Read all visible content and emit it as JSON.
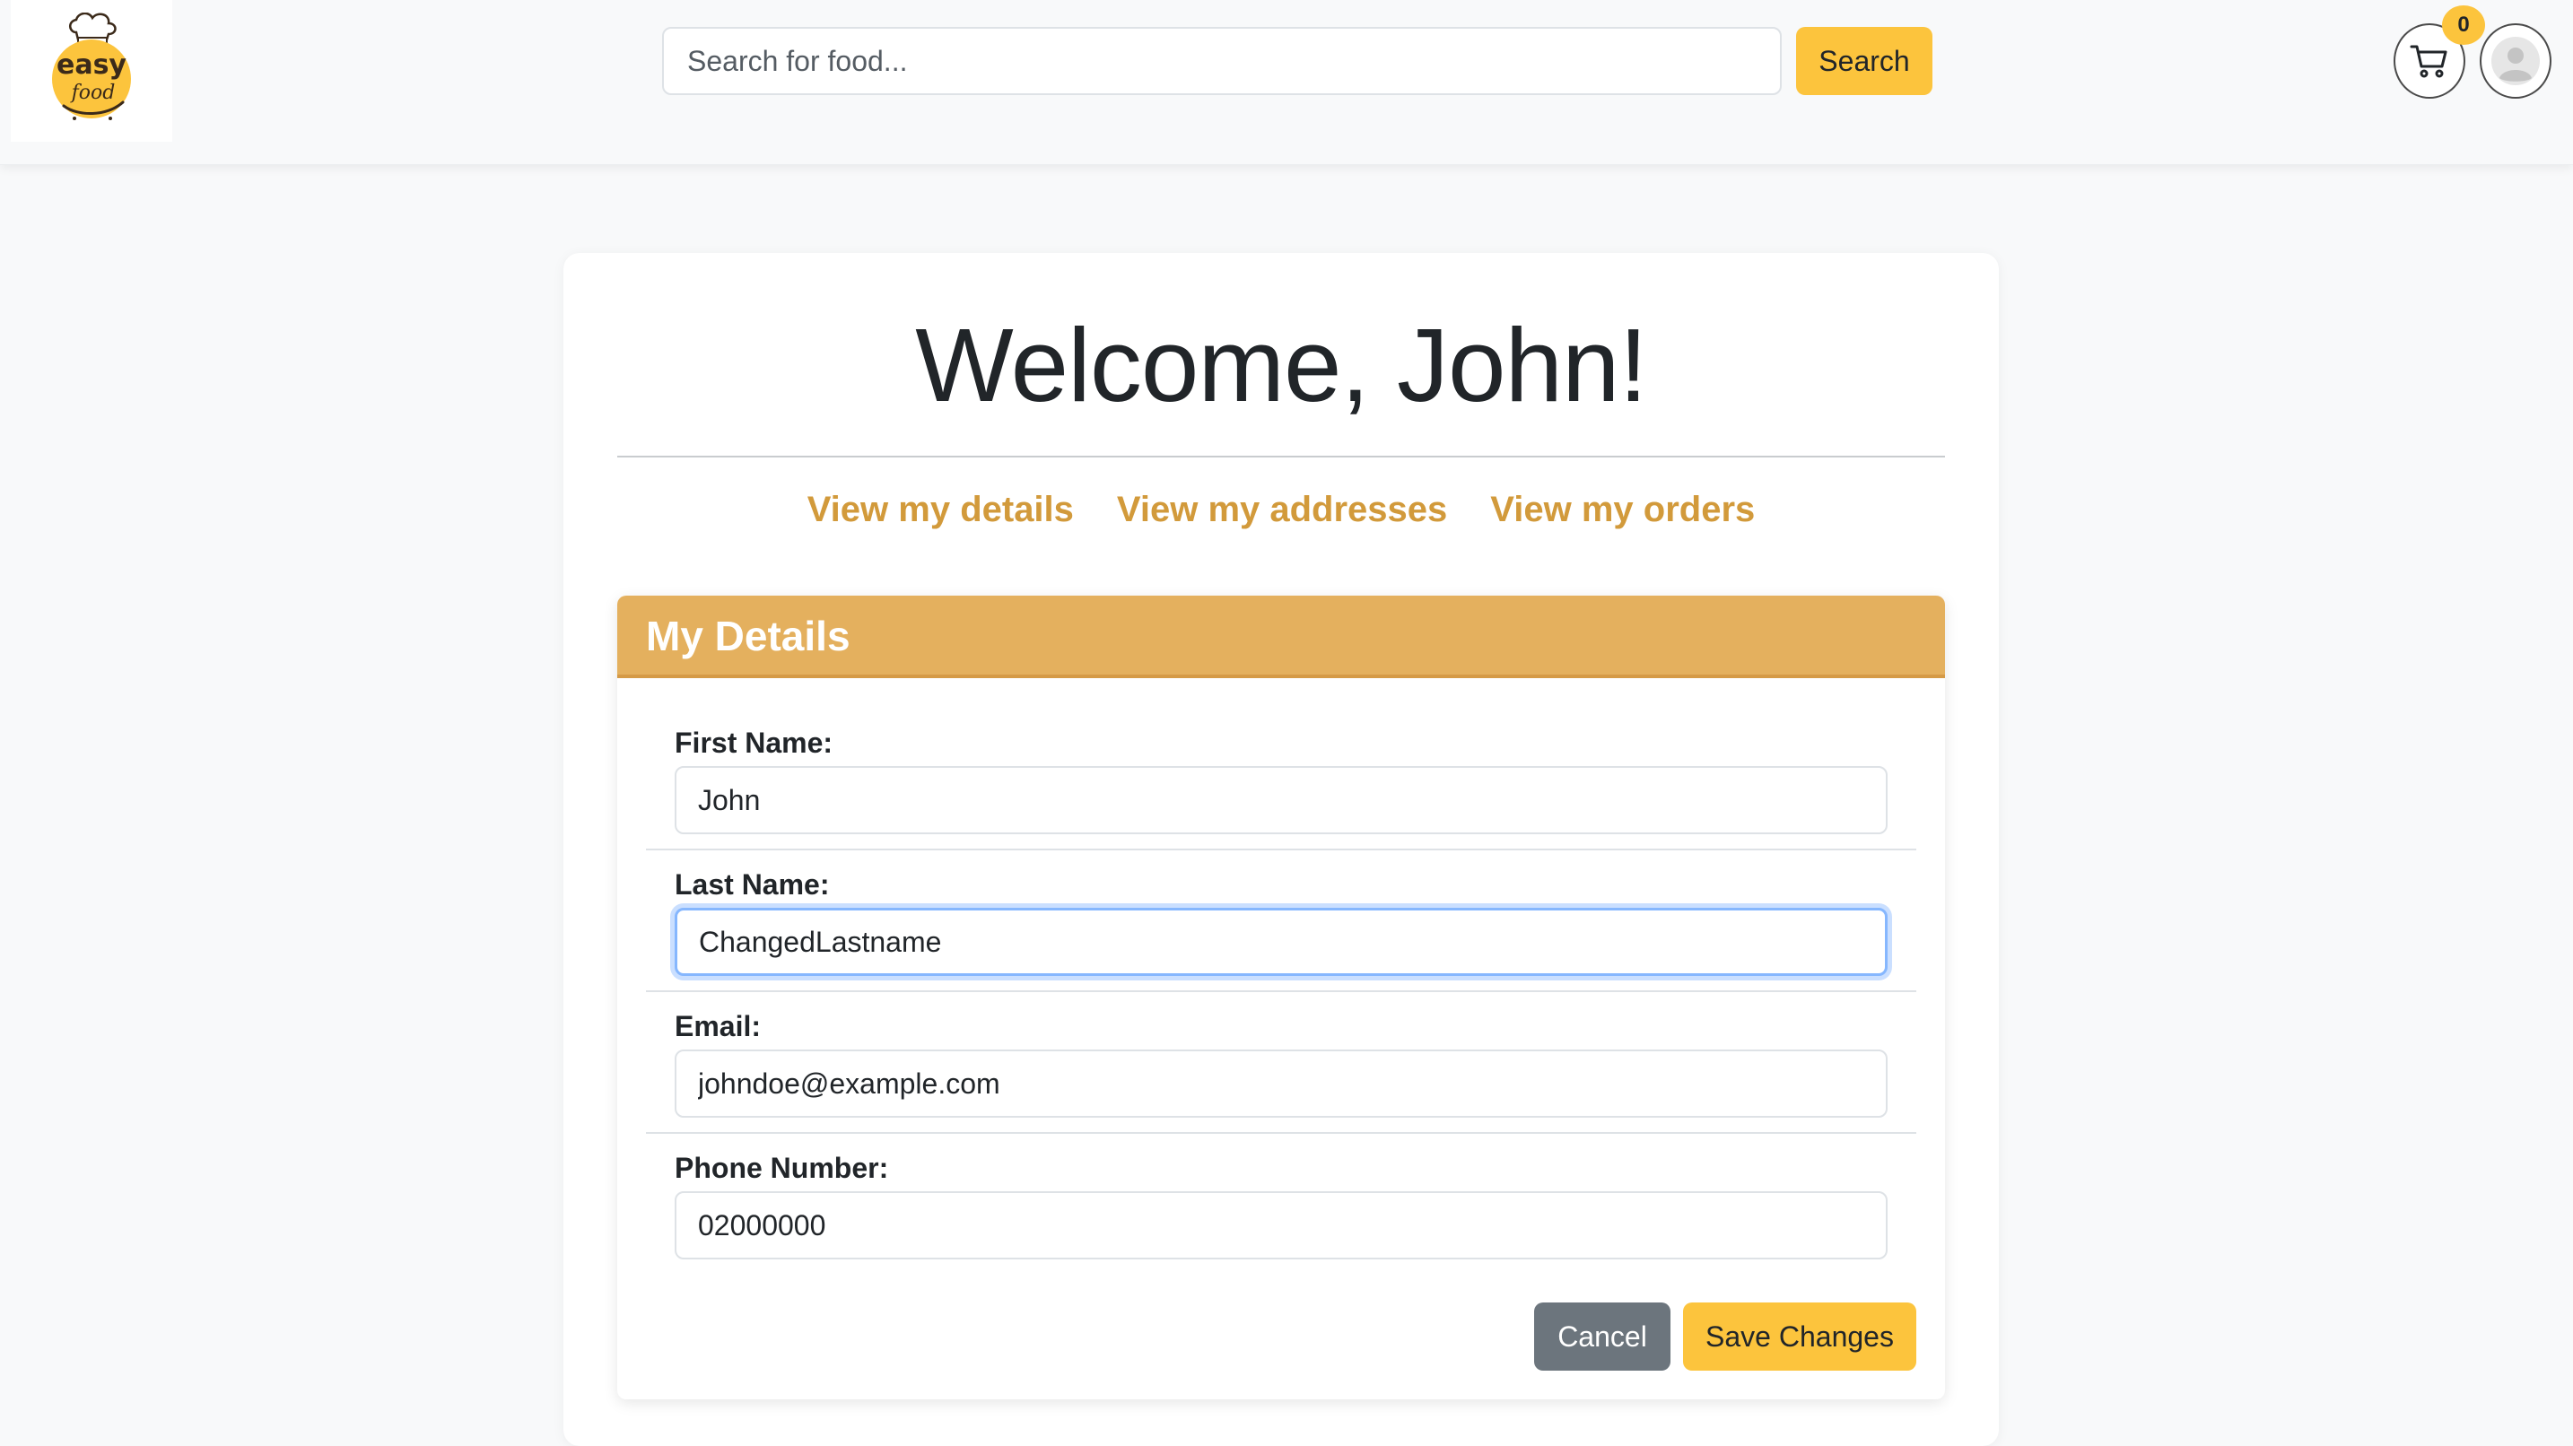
{
  "header": {
    "logo_text_top": "easy",
    "logo_text_bottom": "food",
    "search_placeholder": "Search for food...",
    "search_button": "Search",
    "cart_count": "0",
    "colors": {
      "accent": "#fcc43d",
      "background": "#f8f9fa"
    }
  },
  "main": {
    "welcome": "Welcome, John!",
    "links": [
      {
        "label": "View my details"
      },
      {
        "label": "View my addresses"
      },
      {
        "label": "View my orders"
      }
    ],
    "link_color": "#d29a3b"
  },
  "details": {
    "title": "My Details",
    "header_color": "#e4b05e",
    "fields": [
      {
        "label": "First Name:",
        "value": "John"
      },
      {
        "label": "Last Name:",
        "value": "ChangedLastname"
      },
      {
        "label": "Email:",
        "value": "johndoe@example.com"
      },
      {
        "label": "Phone Number:",
        "value": "02000000"
      }
    ],
    "cancel_label": "Cancel",
    "save_label": "Save Changes"
  }
}
